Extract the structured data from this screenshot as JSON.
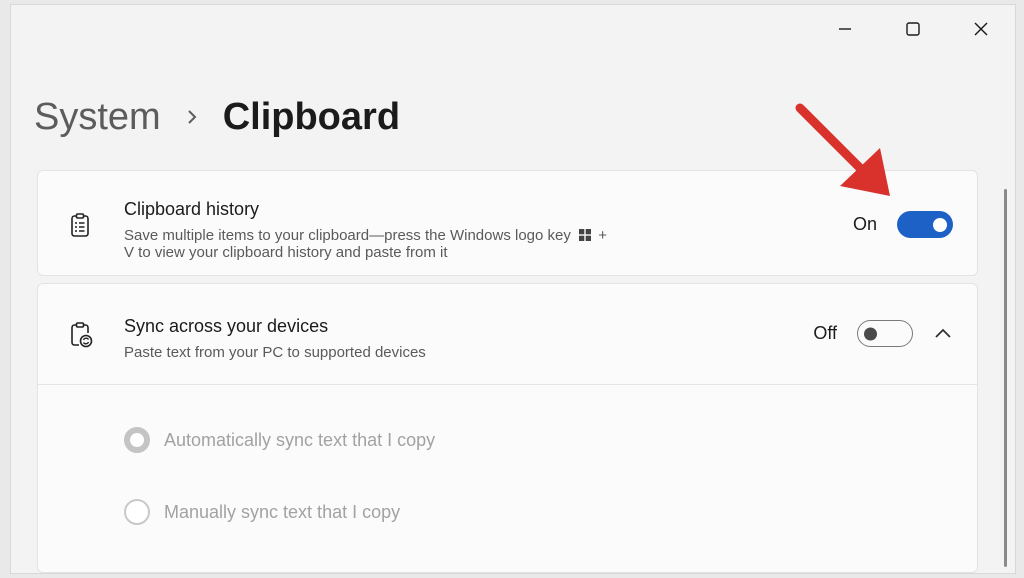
{
  "window": {
    "controls": [
      {
        "name": "minimize-button",
        "icon": "minimize-icon"
      },
      {
        "name": "maximize-button",
        "icon": "maximize-icon"
      },
      {
        "name": "close-button",
        "icon": "close-icon"
      }
    ]
  },
  "breadcrumb": {
    "parent": "System",
    "separator_icon": "chevron-right-icon",
    "current": "Clipboard"
  },
  "clipboard_history": {
    "icon": "clipboard-list-icon",
    "title": "Clipboard history",
    "description_line1": "Save multiple items to your clipboard—press the Windows logo key",
    "description_key_icon": "windows-logo-icon",
    "description_plus": "+",
    "description_line2": "V to view your clipboard history and paste from it",
    "toggle_label": "On",
    "toggle_state": "on"
  },
  "sync": {
    "icon": "clipboard-sync-icon",
    "title": "Sync across your devices",
    "description": "Paste text from your PC to supported devices",
    "toggle_label": "Off",
    "toggle_state": "off",
    "expand_icon": "chevron-up-icon",
    "options": [
      {
        "label": "Automatically sync text that I copy",
        "selected": true,
        "enabled": false
      },
      {
        "label": "Manually sync text that I copy",
        "selected": false,
        "enabled": false
      }
    ]
  },
  "colors": {
    "accent": "#1d61c7",
    "annotation_arrow": "#d9322c",
    "window_background": "#f3f3f3",
    "card_background": "#fbfbfb"
  }
}
